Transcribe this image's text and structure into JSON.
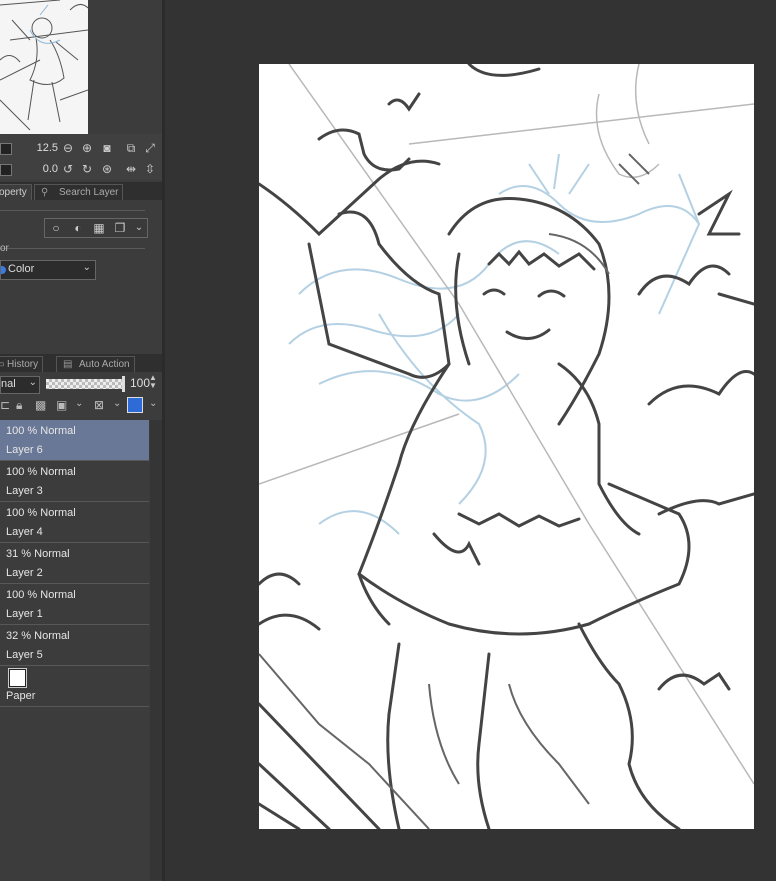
{
  "navigator": {
    "zoom": "12.5",
    "rotation": "0.0"
  },
  "property_tabs": {
    "property": "operty",
    "search_layer": "Search Layer"
  },
  "property": {
    "expression_label": "or",
    "expression_color": "Color"
  },
  "layer_tabs": {
    "history": "History",
    "auto_action": "Auto Action"
  },
  "layer_toolbar": {
    "blend_mode": "nal",
    "opacity": "100"
  },
  "layers": [
    {
      "mode": "100 % Normal",
      "name": "Layer 6"
    },
    {
      "mode": "100 % Normal",
      "name": "Layer 3"
    },
    {
      "mode": "100 % Normal",
      "name": "Layer 4"
    },
    {
      "mode": "31 % Normal",
      "name": "Layer 2"
    },
    {
      "mode": "100 % Normal",
      "name": "Layer 1"
    },
    {
      "mode": "32 % Normal",
      "name": "Layer 5"
    }
  ],
  "paper": {
    "name": "Paper"
  },
  "colors": {
    "selected_layer": "#6a7897",
    "sketch_blue": "#9fc3dc"
  }
}
